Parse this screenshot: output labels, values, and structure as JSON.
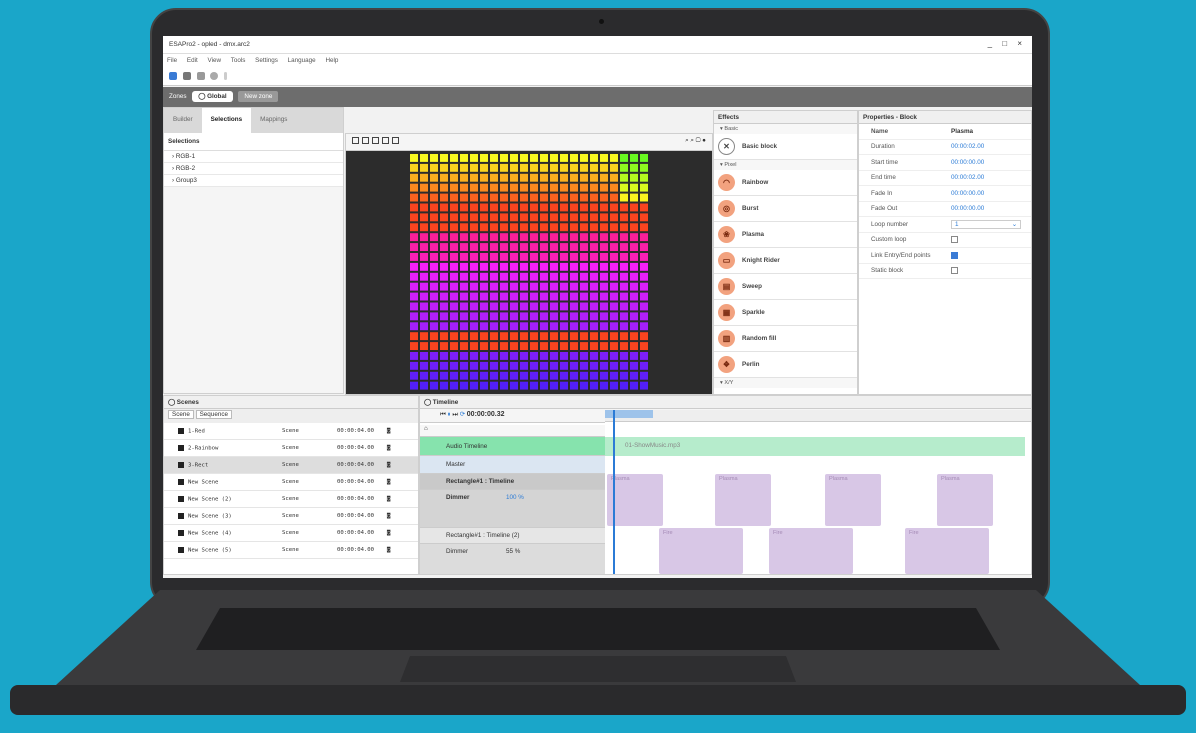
{
  "window": {
    "title": "ESAPro2 - opled - dmx.arc2",
    "controls": "_ □ ×"
  },
  "menu": [
    "File",
    "Edit",
    "View",
    "Tools",
    "Settings",
    "Language",
    "Help"
  ],
  "zones": {
    "label": "Zones",
    "global": "Global",
    "new_zone": "New zone"
  },
  "left_tabs": [
    "Builder",
    "Selections",
    "Mappings"
  ],
  "selections": {
    "header": "Selections",
    "items": [
      "RGB-1",
      "RGB-2",
      "Group3"
    ]
  },
  "effects": {
    "header": "Effects",
    "categories": [
      "Basic",
      "Pixel",
      "X/Y"
    ],
    "basic": [
      "Basic block"
    ],
    "pixel": [
      "Rainbow",
      "Burst",
      "Plasma",
      "Knight Rider",
      "Sweep",
      "Sparkle",
      "Random fill",
      "Perlin"
    ]
  },
  "properties": {
    "header": "Properties - Block",
    "name_key": "Name",
    "name_val": "Plasma",
    "rows": [
      {
        "k": "Duration",
        "v": "00:00:02.00"
      },
      {
        "k": "Start time",
        "v": "00:00:00.00"
      },
      {
        "k": "End time",
        "v": "00:00:02.00"
      },
      {
        "k": "Fade In",
        "v": "00:00:00.00"
      },
      {
        "k": "Fade Out",
        "v": "00:00:00.00"
      },
      {
        "k": "Loop number",
        "v": "1"
      }
    ],
    "checks": [
      {
        "k": "Custom loop",
        "on": false
      },
      {
        "k": "Link Entry/End points",
        "on": true
      },
      {
        "k": "Static block",
        "on": false
      }
    ]
  },
  "scenes": {
    "header": "Scenes",
    "buttons": [
      "Scene",
      "Sequence"
    ],
    "rows": [
      {
        "name": "1-Red",
        "type": "Scene",
        "dur": "00:00:04.00"
      },
      {
        "name": "2-Rainbow",
        "type": "Scene",
        "dur": "00:00:04.00"
      },
      {
        "name": "3-Rect",
        "type": "Scene",
        "dur": "00:00:04.00"
      },
      {
        "name": "New Scene",
        "type": "Scene",
        "dur": "00:00:04.00"
      },
      {
        "name": "New Scene (2)",
        "type": "Scene",
        "dur": "00:00:04.00"
      },
      {
        "name": "New Scene (3)",
        "type": "Scene",
        "dur": "00:00:04.00"
      },
      {
        "name": "New Scene (4)",
        "type": "Scene",
        "dur": "00:00:04.00"
      },
      {
        "name": "New Scene (5)",
        "type": "Scene",
        "dur": "00:00:04.00"
      }
    ]
  },
  "timeline": {
    "header": "Timeline",
    "time": "00:00:00.32",
    "tracks": {
      "audio": "Audio Timeline",
      "audio_file": "01-ShowMusic.mp3",
      "master": "Master",
      "rect1": "Rectangle#1 : Timeline",
      "dimmer1": "Dimmer",
      "dimmer1_val": "100 %",
      "rect2": "Rectangle#1 : Timeline (2)",
      "dimmer2": "Dimmer",
      "dimmer2_val": "55 %"
    },
    "clip_plasma": "Plasma",
    "clip_fire": "Fire"
  },
  "colors": {
    "accent": "#2b7bd6",
    "audio": "#86e3ad",
    "clip": "#d8c7e6",
    "bg": "#1aa6c9"
  }
}
